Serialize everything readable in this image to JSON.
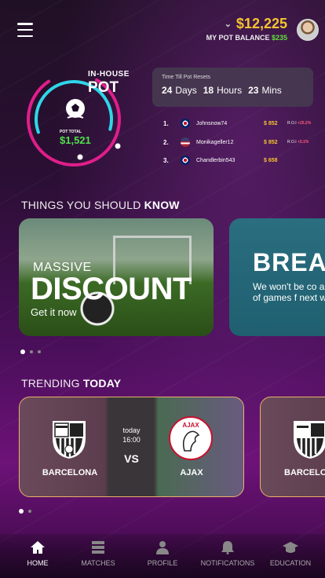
{
  "header": {
    "balance": "$12,225",
    "pot_label": "MY POT BALANCE",
    "pot_value": "$235"
  },
  "pot": {
    "title_small": "IN-HOUSE",
    "title_big": "POT",
    "total_label": "POT TOTAL",
    "total_value": "$1,521"
  },
  "reset": {
    "label": "Time Till Pot Resets",
    "days": "24",
    "days_u": "Days",
    "hours": "18",
    "hours_u": "Hours",
    "mins": "23",
    "mins_u": "Mins"
  },
  "leaderboard": [
    {
      "rank": "1.",
      "flag": "uk",
      "name": "Johnsnow74",
      "points": "$ 852",
      "roi": "R.O.I",
      "roi_v": "+25.2%"
    },
    {
      "rank": "2.",
      "flag": "us",
      "name": "Monikageller12",
      "points": "$ 852",
      "roi": "R.O.I",
      "roi_v": "+5.1%"
    },
    {
      "rank": "3.",
      "flag": "uk",
      "name": "Chandlerbin543",
      "points": "$ 658",
      "roi": "",
      "roi_v": ""
    }
  ],
  "know": {
    "a": "THINGS YOU SHOULD ",
    "b": "KNOW"
  },
  "promo": {
    "line1": "MASSIVE",
    "line2": "DISCOUNT",
    "cta": "Get it now"
  },
  "promo2": {
    "title": "BREA",
    "desc": "We won't be co a lot of games f next week."
  },
  "trending": {
    "a": "TRENDING ",
    "b": "TODAY"
  },
  "match": {
    "home": "BARCELONA",
    "away": "AJAX",
    "day": "today",
    "time": "16:00",
    "vs": "VS"
  },
  "match2": {
    "home": "BARCELO"
  },
  "nav": [
    {
      "label": "HOME",
      "icon": "home-icon"
    },
    {
      "label": "MATCHES",
      "icon": "list-icon"
    },
    {
      "label": "PROFILE",
      "icon": "user-icon"
    },
    {
      "label": "NOTIFICATIONS",
      "icon": "bell-icon"
    },
    {
      "label": "EDUCATION",
      "icon": "graduation-cap-icon"
    }
  ],
  "colors": {
    "gold": "#f4c430",
    "green": "#4fe24a",
    "accent": "#e01e8a",
    "cyan": "#2fd6e8"
  }
}
